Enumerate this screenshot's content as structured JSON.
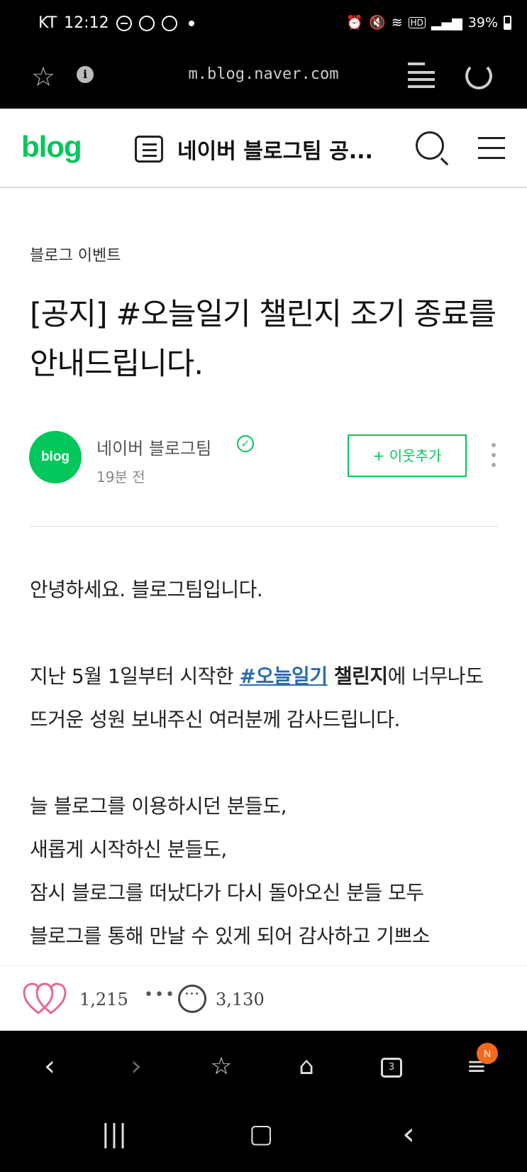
{
  "status_bar": {
    "carrier": "KT",
    "time": "12:12",
    "hd_label": "HD",
    "battery": "39%"
  },
  "browser": {
    "url": "m.blog.naver.com"
  },
  "header": {
    "logo": "blog",
    "title": "네이버 블로그팀 공..."
  },
  "post": {
    "category": "블로그 이벤트",
    "title": "[공지] #오늘일기 챌린지 조기 종료를 안내드립니다.",
    "author": {
      "avatar_text": "blog",
      "name": "네이버 블로그팀",
      "time": "19분 전"
    },
    "add_neighbor_label": "+ 이웃추가",
    "body": {
      "greeting": "안녕하세요. 블로그팀입니다.",
      "p2_before": "지난 5월 1일부터 시작한 ",
      "p2_hashtag": "#오늘일기",
      "p2_bold": " 챌린지",
      "p2_after": "에 너무나도 뜨거운 성원 보내주신 여러분께 감사드립니다.",
      "lines": [
        "늘 블로그를 이용하시던 분들도,",
        "새롭게 시작하신 분들도,",
        "잠시 블로그를 떠났다가 다시 돌아오신 분들 모두",
        "블로그를 통해 만날 수 있게 되어 감사하고 기쁘소"
      ]
    }
  },
  "actions": {
    "like_count": "1,215",
    "more": "•••",
    "comment_count": "3,130"
  },
  "browser_nav": {
    "tabs_count": "3",
    "badge": "N"
  },
  "colors": {
    "brand_green": "#03c75a",
    "hashtag_blue": "#2b6cb0",
    "like_pink": "#e36b8f",
    "badge_orange": "#f26b1d"
  }
}
